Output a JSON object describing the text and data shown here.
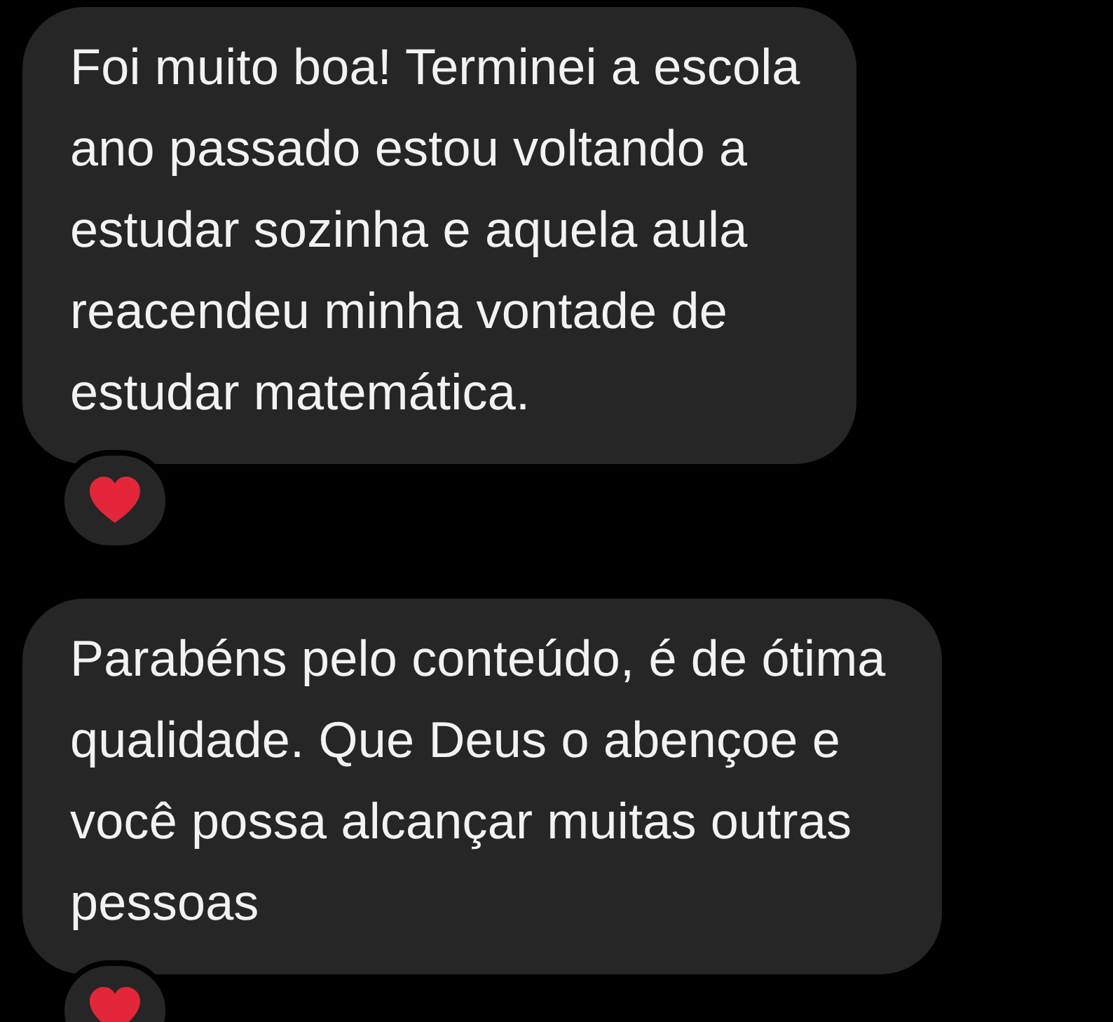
{
  "messages": [
    {
      "text": "Foi muito boa! Terminei a escola\nano passado estou voltando a\nestudar sozinha e aquela aula\nreacendeu minha vontade de\nestudar matemática.",
      "reacted": true
    },
    {
      "text": "Parabéns pelo conteúdo, é de ótima\nqualidade. Que Deus o abençoe e\nvocê possa alcançar muitas outras\npessoas",
      "reacted": true
    }
  ]
}
